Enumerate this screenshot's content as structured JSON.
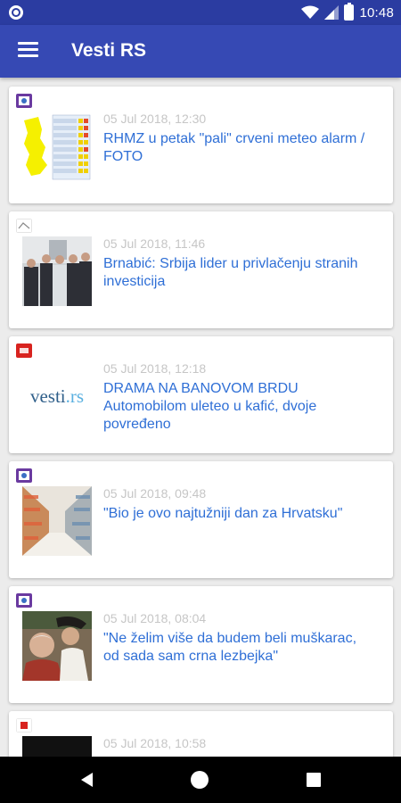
{
  "status_bar": {
    "time": "10:48"
  },
  "app_bar": {
    "title": "Vesti RS"
  },
  "articles": [
    {
      "time": "05 Jul 2018, 12:30",
      "headline": "RHMZ u petak \"pali\" crveni meteo alarm / FOTO",
      "source_icon": "rhmz-source-icon",
      "thumb": "meteo-map-thumbnail"
    },
    {
      "time": "05 Jul 2018, 11:46",
      "headline": "Brnabić: Srbija lider u privlačenju stranih investicija",
      "source_icon": "source-icon",
      "thumb": "group-photo-thumbnail"
    },
    {
      "time": "05 Jul 2018, 12:18",
      "headline": "DRAMA NA BANOVOM BRDU Automobilom uleteo u kafić, dvoje povređeno",
      "source_icon": "b92-source-icon",
      "thumb": "vesti-rs-logo-thumbnail",
      "thumb_text": "vesti",
      "thumb_text_suffix": ".rs"
    },
    {
      "time": "05 Jul 2018, 09:48",
      "headline": "\"Bio je ovo najtužniji dan za Hrvatsku\"",
      "source_icon": "source-icon",
      "thumb": "supermarket-aisle-thumbnail"
    },
    {
      "time": "05 Jul 2018, 08:04",
      "headline": "\"Ne želim više da budem beli muškarac, od sada sam crna lezbejka\"",
      "source_icon": "source-icon",
      "thumb": "portrait-thumbnail"
    },
    {
      "time": "05 Jul 2018, 10:58",
      "headline": "",
      "source_icon": "source-icon",
      "thumb": "dark-thumbnail"
    }
  ],
  "colors": {
    "app_bar": "#3649b4",
    "status_bar": "#2b3ca1",
    "headline": "#2f6fd6",
    "timestamp": "#c6c6c6"
  }
}
